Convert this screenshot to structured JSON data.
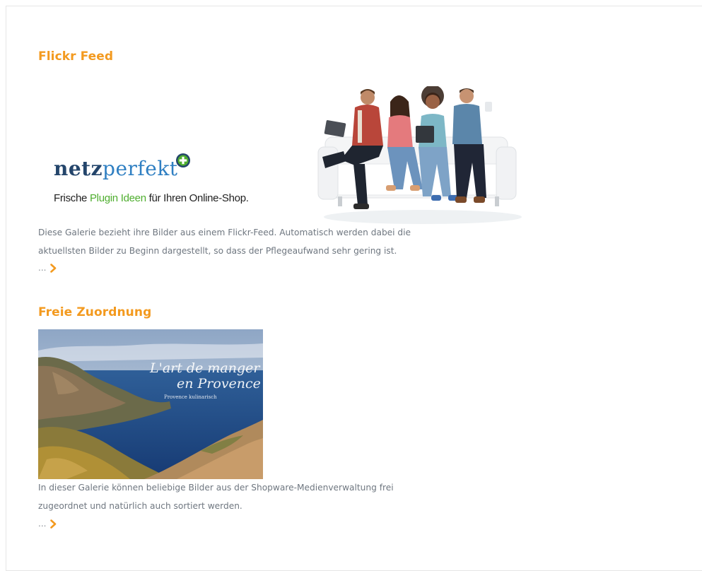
{
  "sections": [
    {
      "title": "Flickr Feed",
      "description_line_1": "Diese Galerie bezieht ihre Bilder aus einem Flickr-Feed. Automatisch werden dabei die",
      "description_line_2": "aktuellsten Bilder zu Beginn dargestellt, so dass der Pflegeaufwand sehr gering ist.",
      "more_label": "...",
      "image": {
        "brand_a": "netz",
        "brand_b": "perfekt",
        "tagline_a": "Frische ",
        "tagline_b": "Plugin Ideen",
        "tagline_c": " für Ihren Online-Shop."
      }
    },
    {
      "title": "Freie Zuordnung",
      "description_line_1": "In dieser Galerie können beliebige Bilder aus der Shopware-Medienverwaltung frei",
      "description_line_2": "zugeordnet und natürlich auch sortiert werden.",
      "more_label": "...",
      "image": {
        "line_1": "L'art de manger",
        "line_2": "en Provence",
        "line_3": "Provence kulinarisch"
      }
    }
  ],
  "colors": {
    "accent": "#f39a1f",
    "text": "#6f7780",
    "brand_navy": "#24456b",
    "brand_green": "#4fae2f"
  },
  "icons": {
    "more": "chevron-right-icon",
    "brand_badge": "plus-badge-icon"
  }
}
